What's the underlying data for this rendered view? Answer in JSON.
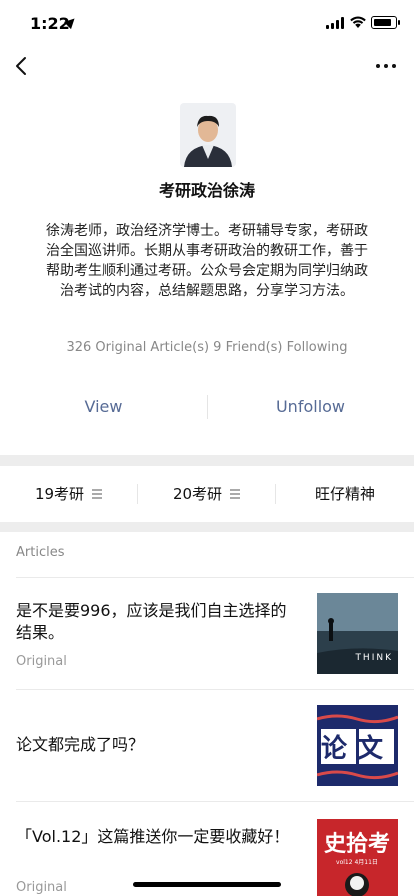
{
  "status": {
    "time": "1:22",
    "battery_level": 0.85
  },
  "nav": {
    "back_icon": "chevron-left-icon",
    "more_icon": "more-dots-icon"
  },
  "profile": {
    "name": "考研政治徐涛",
    "description": "徐涛老师，政治经济学博士。考研辅导专家，考研政治全国巡讲师。长期从事考研政治的教研工作，善于帮助考生顺利通过考研。公众号会定期为同学归纳政治考试的内容，总结解题思路，分享学习方法。",
    "stats": "326 Original Article(s)  9 Friend(s) Following"
  },
  "actions": {
    "view_label": "View",
    "unfollow_label": "Unfollow"
  },
  "menu": {
    "items": [
      {
        "label": "19考研",
        "has_submenu": true
      },
      {
        "label": "20考研",
        "has_submenu": true
      },
      {
        "label": "旺仔精神",
        "has_submenu": false
      }
    ]
  },
  "articles_section": {
    "header": "Articles",
    "items": [
      {
        "title": "是不是要996，应该是我们自主选择的结果。",
        "tag": "Original",
        "thumb_text": "THINK"
      },
      {
        "title": "论文都完成了吗？",
        "tag": "",
        "thumb_text": "论文"
      },
      {
        "title": "「Vol.12」这篇推送你一定要收藏好！",
        "tag": "Original",
        "thumb_text": "史拾考",
        "thumb_subtext": "vol12  4月11日"
      }
    ]
  },
  "colors": {
    "link": "#576b95",
    "band": "#ededed",
    "muted": "#888888"
  }
}
